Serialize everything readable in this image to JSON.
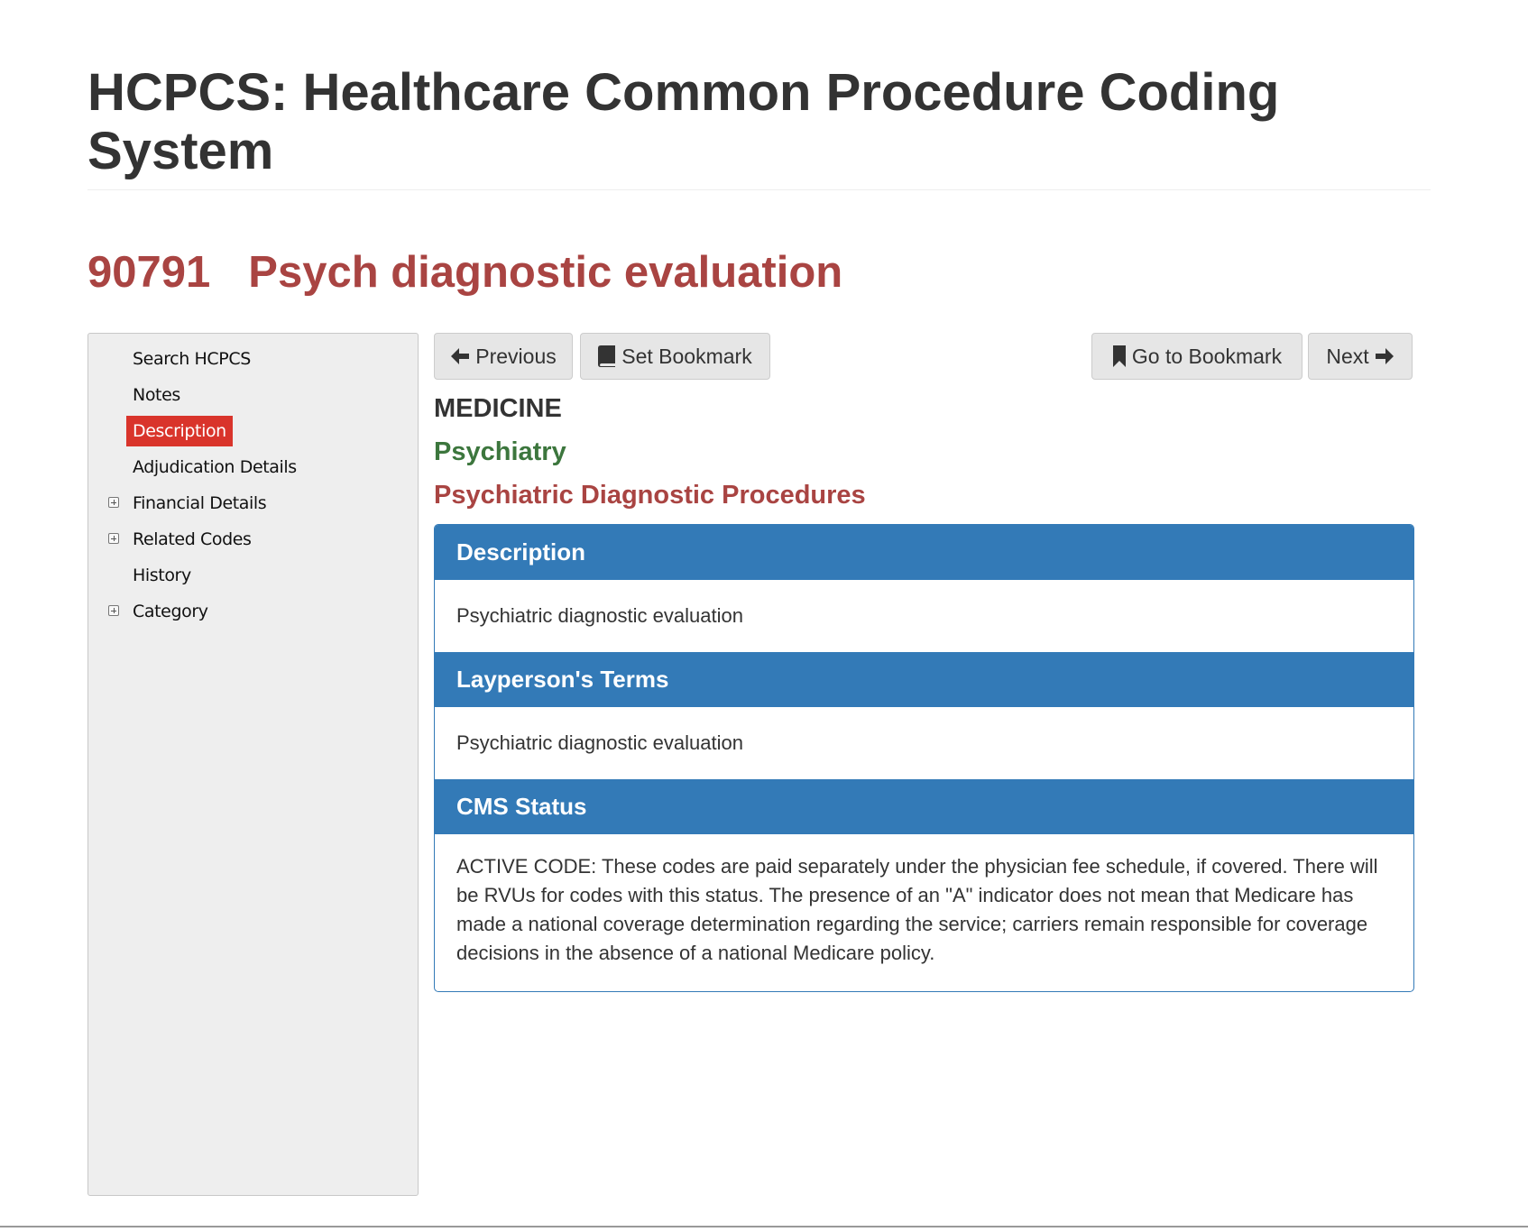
{
  "page": {
    "title": "HCPCS: Healthcare Common Procedure Coding System"
  },
  "code": {
    "number": "90791",
    "short_desc": "Psych diagnostic evaluation"
  },
  "sidebar": {
    "items": [
      {
        "label": "Search HCPCS",
        "expandable": false,
        "active": false
      },
      {
        "label": "Notes",
        "expandable": false,
        "active": false
      },
      {
        "label": "Description",
        "expandable": false,
        "active": true
      },
      {
        "label": "Adjudication Details",
        "expandable": false,
        "active": false
      },
      {
        "label": "Financial Details",
        "expandable": true,
        "active": false
      },
      {
        "label": "Related Codes",
        "expandable": true,
        "active": false
      },
      {
        "label": "History",
        "expandable": false,
        "active": false
      },
      {
        "label": "Category",
        "expandable": true,
        "active": false
      }
    ]
  },
  "toolbar": {
    "previous_label": "Previous",
    "set_bookmark_label": "Set Bookmark",
    "go_to_bookmark_label": "Go to Bookmark",
    "next_label": "Next"
  },
  "category": {
    "section": "MEDICINE",
    "subsection": "Psychiatry",
    "group": "Psychiatric Diagnostic Procedures"
  },
  "panels": [
    {
      "heading": "Description",
      "body": "Psychiatric diagnostic evaluation"
    },
    {
      "heading": "Layperson's Terms",
      "body": "Psychiatric diagnostic evaluation"
    },
    {
      "heading": "CMS Status",
      "body": "ACTIVE CODE: These codes are paid separately under the physician fee schedule, if covered. There will be RVUs for codes with this status. The presence of an \"A\" indicator does not mean that Medicare has made a national coverage determination regarding the service; carriers remain responsible for coverage decisions in the absence of a national Medicare policy."
    }
  ],
  "colors": {
    "primary": "#337ab7",
    "danger_text": "#a94442",
    "success_text": "#3c763d",
    "active_item": "#d9342b",
    "sidebar_bg": "#eeeeee"
  },
  "icons": {
    "previous": "arrow-left-icon",
    "set_bookmark": "book-icon",
    "go_to_bookmark": "bookmark-icon",
    "next": "arrow-right-icon",
    "expander": "plus-square-icon"
  }
}
